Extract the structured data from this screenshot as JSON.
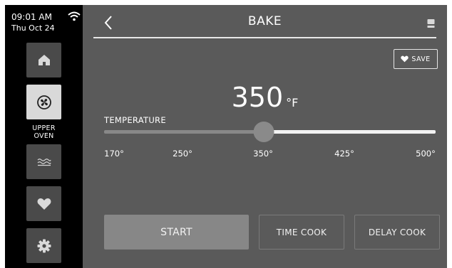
{
  "status": {
    "time": "09:01 AM",
    "date": "Thu Oct 24"
  },
  "sidebar": {
    "items": [
      {
        "icon": "home-icon"
      },
      {
        "icon": "fan-icon",
        "label_line1": "UPPER",
        "label_line2": "OVEN",
        "active": true
      },
      {
        "icon": "lower-oven-icon"
      },
      {
        "icon": "heart-icon"
      },
      {
        "icon": "gear-icon"
      }
    ]
  },
  "header": {
    "title": "BAKE"
  },
  "save": {
    "label": "SAVE"
  },
  "temperature": {
    "label": "TEMPERATURE",
    "value": "350",
    "unit": "°F",
    "slider_min": 170,
    "slider_max": 500,
    "slider_value": 350,
    "ticks": [
      "170°",
      "250°",
      "350°",
      "425°",
      "500°"
    ]
  },
  "actions": {
    "start": "START",
    "time_cook": "TIME COOK",
    "delay_cook": "DELAY COOK"
  },
  "colors": {
    "sidebar_bg": "#000000",
    "main_bg": "#5a5a5a",
    "active_button": "#d9d9d9",
    "start_button": "#878787"
  }
}
